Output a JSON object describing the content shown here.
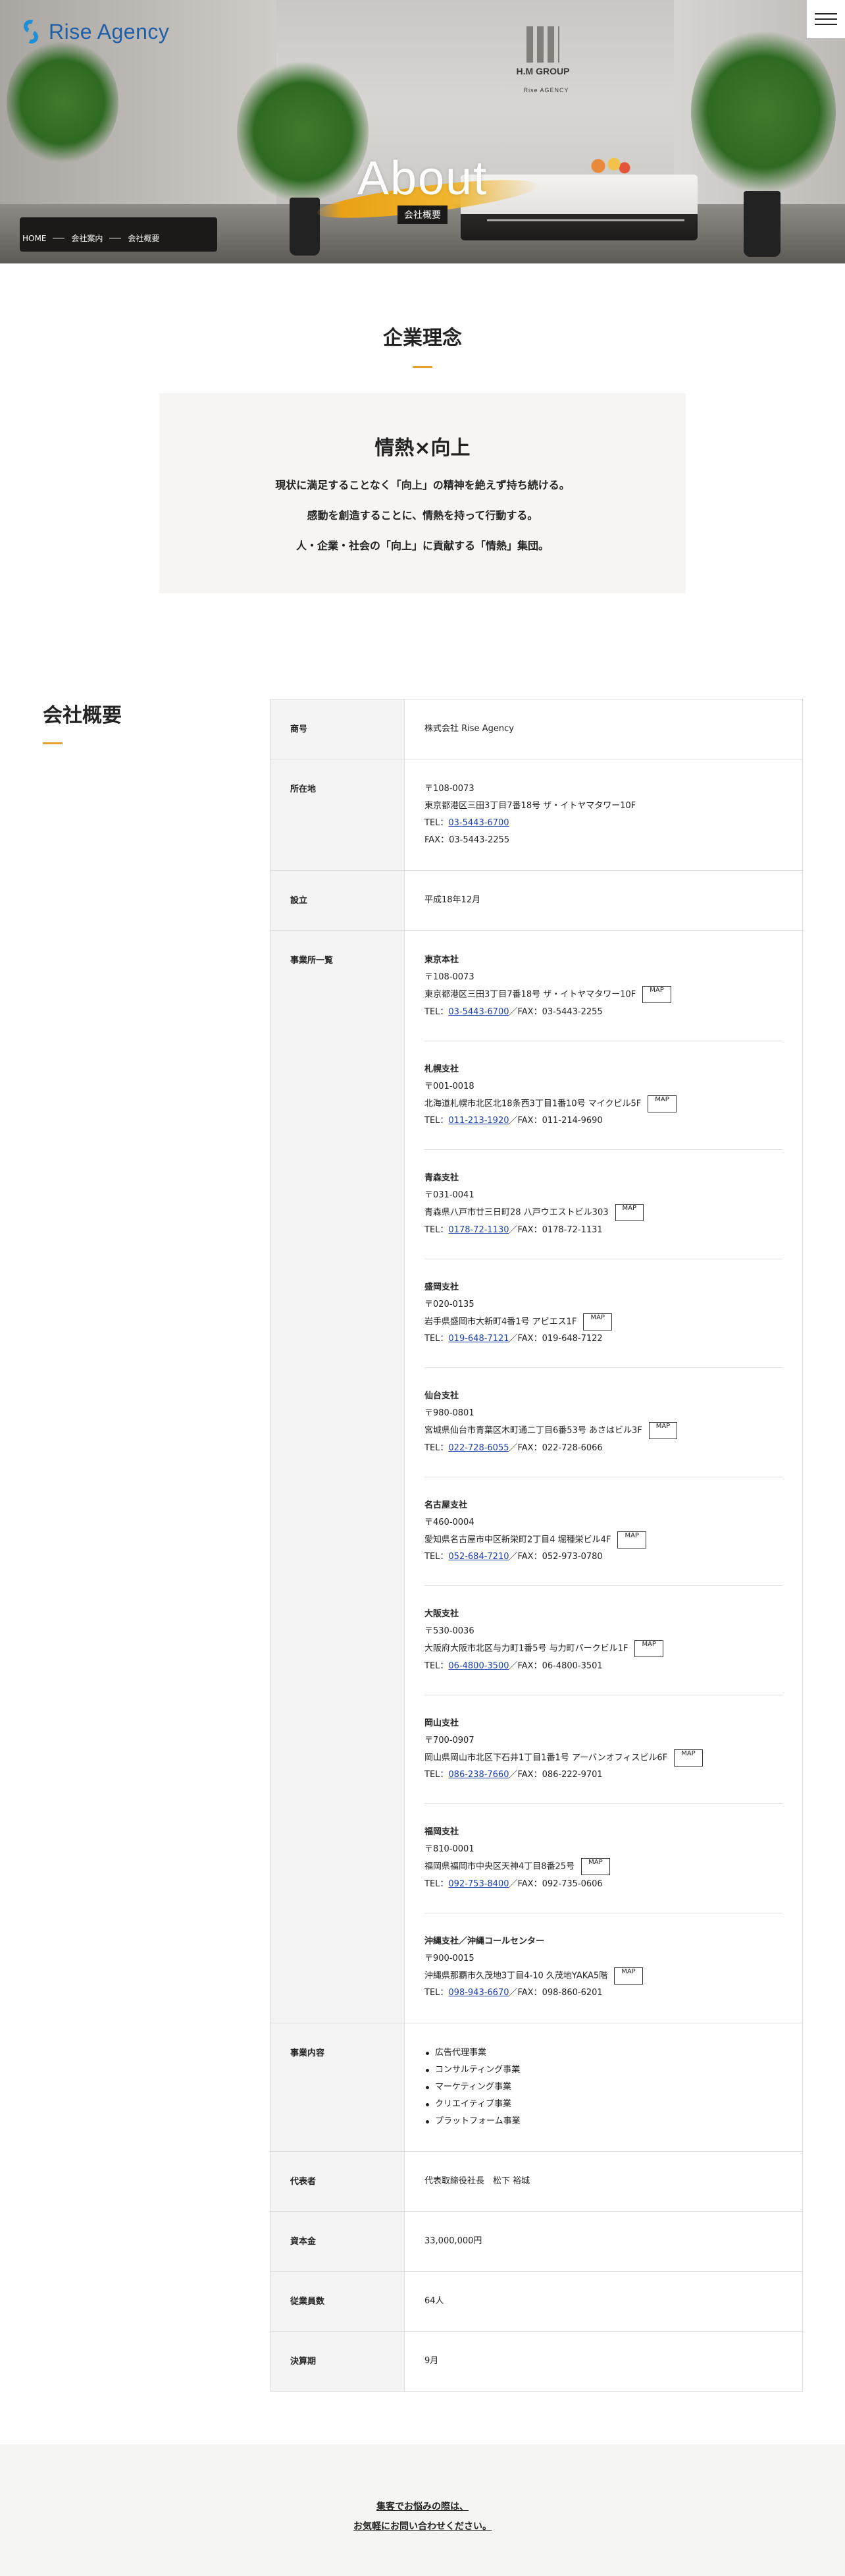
{
  "header": {
    "logo_text": "Rise Agency",
    "menu_icon": "hamburger-icon"
  },
  "hero": {
    "title": "About",
    "subtitle": "会社概要",
    "sign_text": "H.M GROUP",
    "sign_subtext": "Rise AGENCY",
    "breadcrumb": [
      "HOME",
      "会社案内",
      "会社概要"
    ]
  },
  "philosophy": {
    "heading": "企業理念",
    "motto": "情熱×向上",
    "lines": [
      "現状に満足することなく「向上」の精神を絶えず持ち続ける。",
      "感動を創造することに、情熱を持って行動する。",
      "人・企業・社会の「向上」に貢献する「情熱」集団。"
    ]
  },
  "company": {
    "heading": "会社概要",
    "rows": {
      "name": {
        "label": "商号",
        "value": "株式会社 Rise Agency"
      },
      "address": {
        "label": "所在地",
        "postal": "〒108-0073",
        "addr": "東京都港区三田3丁目7番18号 ザ・イトヤマタワー10F",
        "tel_prefix": "TEL：",
        "tel": "03-5443-6700",
        "fax": "FAX：03-5443-2255"
      },
      "founded": {
        "label": "設立",
        "value": "平成18年12月"
      },
      "offices": {
        "label": "事業所一覧",
        "map_label": "MAP",
        "tel_prefix": "TEL：",
        "list": [
          {
            "name": "東京本社",
            "postal": "〒108-0073",
            "addr": "東京都港区三田3丁目7番18号 ザ・イトヤマタワー10F",
            "tel": "03-5443-6700",
            "fax": "／FAX：03-5443-2255"
          },
          {
            "name": "札幌支社",
            "postal": "〒001-0018",
            "addr": "北海道札幌市北区北18条西3丁目1番10号 マイクビル5F",
            "tel": "011-213-1920",
            "fax": "／FAX：011-214-9690"
          },
          {
            "name": "青森支社",
            "postal": "〒031-0041",
            "addr": "青森県八戸市廿三日町28 八戸ウエストビル303",
            "tel": "0178-72-1130",
            "fax": "／FAX：0178-72-1131"
          },
          {
            "name": "盛岡支社",
            "postal": "〒020-0135",
            "addr": "岩手県盛岡市大新町4番1号 アビエス1F",
            "tel": "019-648-7121",
            "fax": "／FAX：019-648-7122"
          },
          {
            "name": "仙台支社",
            "postal": "〒980-0801",
            "addr": "宮城県仙台市青葉区木町通二丁目6番53号 あさはビル3F",
            "tel": "022-728-6055",
            "fax": "／FAX：022-728-6066"
          },
          {
            "name": "名古屋支社",
            "postal": "〒460-0004",
            "addr": "愛知県名古屋市中区新栄町2丁目4 堀種栄ビル4F",
            "tel": "052-684-7210",
            "fax": "／FAX：052-973-0780"
          },
          {
            "name": "大阪支社",
            "postal": "〒530-0036",
            "addr": "大阪府大阪市北区与力町1番5号 与力町パークビル1F",
            "tel": "06-4800-3500",
            "fax": "／FAX：06-4800-3501"
          },
          {
            "name": "岡山支社",
            "postal": "〒700-0907",
            "addr": "岡山県岡山市北区下石井1丁目1番1号 アーバンオフィスビル6F",
            "tel": "086-238-7660",
            "fax": "／FAX：086-222-9701"
          },
          {
            "name": "福岡支社",
            "postal": "〒810-0001",
            "addr": "福岡県福岡市中央区天神4丁目8番25号",
            "tel": "092-753-8400",
            "fax": "／FAX：092-735-0606"
          },
          {
            "name": "沖縄支社／沖縄コールセンター",
            "postal": "〒900-0015",
            "addr": "沖縄県那覇市久茂地3丁目4-10 久茂地YAKA5階",
            "tel": "098-943-6670",
            "fax": "／FAX：098-860-6201"
          }
        ]
      },
      "business": {
        "label": "事業内容",
        "items": [
          "広告代理事業",
          "コンサルティング事業",
          "マーケティング事業",
          "クリエイティブ事業",
          "プラットフォーム事業"
        ]
      },
      "ceo": {
        "label": "代表者",
        "value": "代表取締役社長　松下 裕城"
      },
      "capital": {
        "label": "資本金",
        "value": "33,000,000円"
      },
      "employees": {
        "label": "従業員数",
        "value": "64人"
      },
      "fiscal": {
        "label": "決算期",
        "value": "9月"
      }
    }
  },
  "cta": {
    "line1": "集客でお悩みの際は、",
    "line2": "お気軽にお問い合わせください。"
  },
  "colors": {
    "accent": "#e6a12a",
    "brand": "#1f8fd6",
    "link": "#1a3fb0"
  }
}
